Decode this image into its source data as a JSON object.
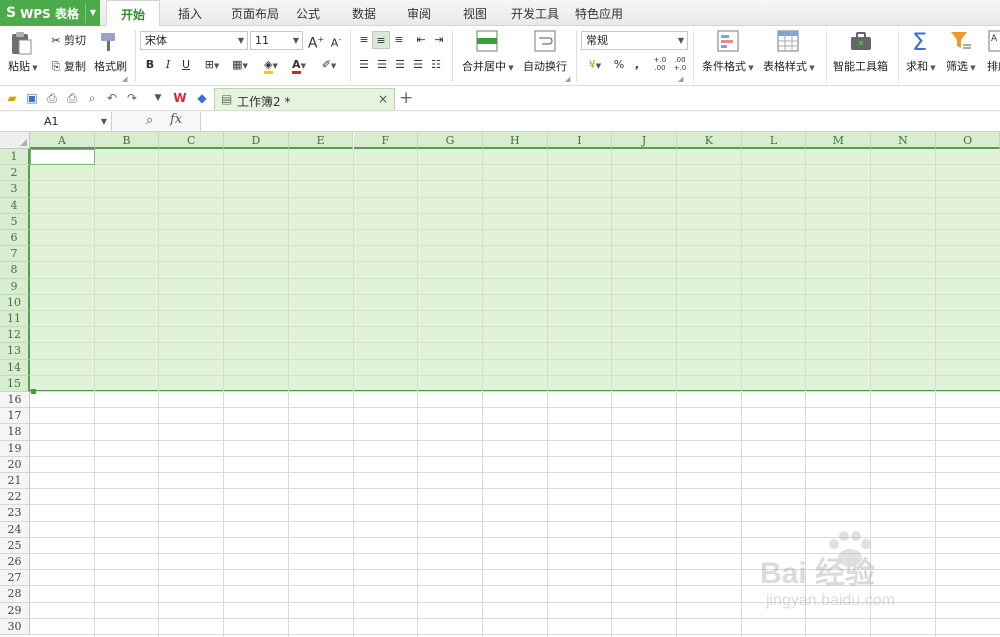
{
  "app": {
    "logo": "S",
    "title": "WPS 表格"
  },
  "menu_tabs": [
    "开始",
    "插入",
    "页面布局",
    "公式",
    "数据",
    "审阅",
    "视图",
    "开发工具",
    "特色应用"
  ],
  "ribbon": {
    "paste": "粘贴",
    "cut": "剪切",
    "copy": "复制",
    "format_painter": "格式刷",
    "font_name": "宋体",
    "font_size": "11",
    "bold": "B",
    "italic": "I",
    "underline": "U",
    "merge_center": "合并居中",
    "wrap_text": "自动换行",
    "number_format": "常规",
    "percent": "%",
    "comma": ",",
    "inc_decimal": "+.0 .00",
    "dec_decimal": ".00 +.0",
    "conditional_format": "条件格式",
    "table_style": "表格样式",
    "smart_toolbox": "智能工具箱",
    "sum": "求和",
    "filter": "筛选",
    "sort": "排序",
    "font_grow": "A",
    "font_shrink": "A"
  },
  "document_tab": {
    "name": "工作簿2 *",
    "close": "×"
  },
  "add_tab": "+",
  "name_box": "A1",
  "fx": "fx",
  "columns": [
    "A",
    "B",
    "C",
    "D",
    "E",
    "F",
    "G",
    "H",
    "I",
    "J",
    "K",
    "L",
    "M",
    "N",
    "O"
  ],
  "rows": [
    "1",
    "2",
    "3",
    "4",
    "5",
    "6",
    "7",
    "8",
    "9",
    "10",
    "11",
    "12",
    "13",
    "14",
    "15",
    "16",
    "17",
    "18",
    "19",
    "20",
    "21",
    "22",
    "23",
    "24",
    "25",
    "26",
    "27",
    "28",
    "29",
    "30"
  ],
  "selected_rows": 15,
  "watermark": {
    "brand": "Bai 经验",
    "url": "jingyan.baidu.com"
  },
  "colors": {
    "accent": "#4caa4a",
    "selection": "#e1f3d6",
    "header_selected": "#d8ecd0",
    "selection_border": "#4b9a43"
  }
}
